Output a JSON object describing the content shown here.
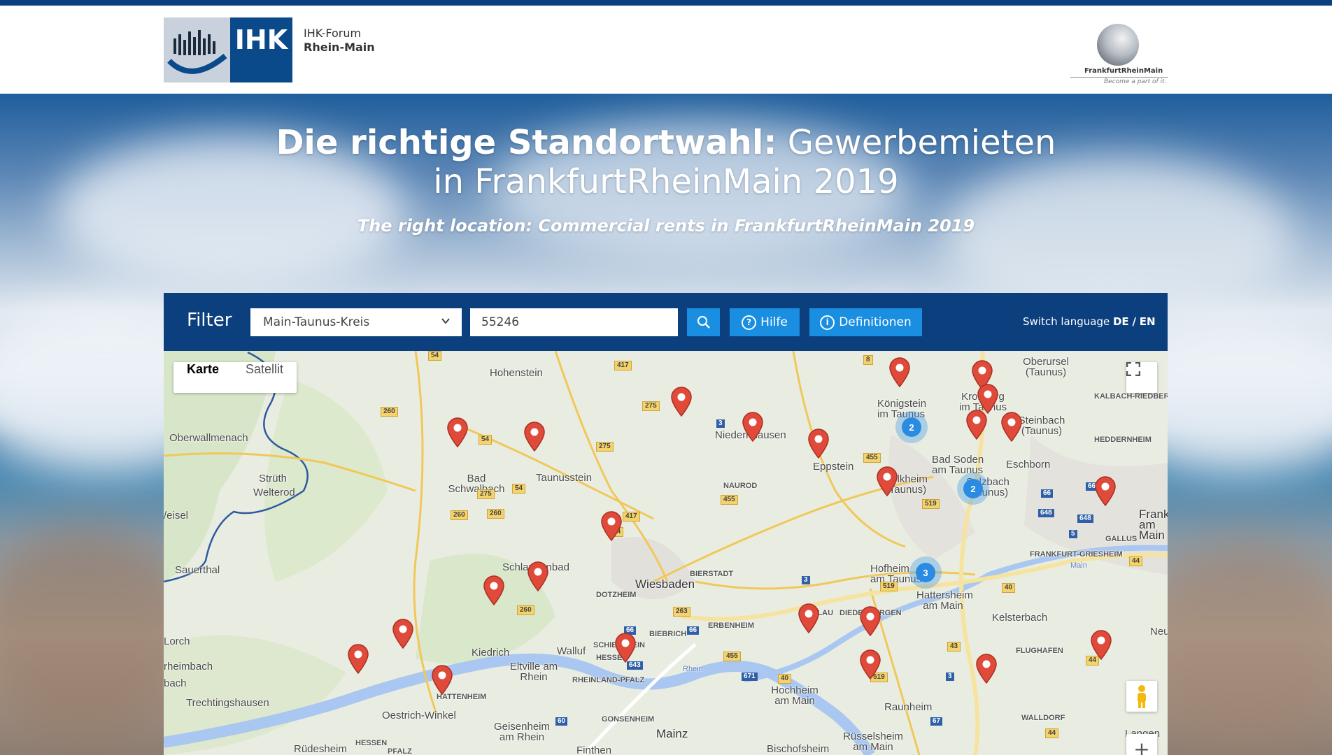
{
  "header": {
    "ihk_logo_text": "IHK",
    "forum_line1": "IHK-Forum",
    "forum_line2": "Rhein-Main",
    "frm_logo_name": "FrankfurtRheinMain",
    "frm_logo_tagline": "Become a part of it."
  },
  "hero": {
    "title_bold": "Die richtige Standortwahl:",
    "title_regular": "Gewerbemieten in FrankfurtRheinMain 2019",
    "subtitle": "The right location: Commercial rents in FrankfurtRheinMain 2019"
  },
  "filter": {
    "label": "Filter",
    "region_selected": "Main-Taunus-Kreis",
    "postal_code": "55246",
    "hilfe_label": "Hilfe",
    "definitionen_label": "Definitionen",
    "switch_language_label": "Switch language",
    "lang_de": "DE",
    "lang_sep": "/",
    "lang_en": "EN"
  },
  "map": {
    "type_map": "Karte",
    "type_satellite": "Satellit",
    "clusters": [
      "2",
      "2",
      "3"
    ],
    "places": {
      "hohenstein": "Hohenstein",
      "oberwallmenach": "Oberwallmenach",
      "strueth": "Strüth",
      "welterod": "Welterod",
      "eisel": "/eisel",
      "sauerthal": "Sauerthal",
      "orch": "Lorch",
      "rheimbach": "rheimbach",
      "bach": "bach",
      "trechtingshausen": "Trechtingshausen",
      "ruedesheim": "Rüdesheim",
      "bad_schwalbach": "Bad Schwalbach",
      "taunusstein": "Taunusstein",
      "niedernhausen": "Niedernhausen",
      "eppstein": "Eppstein",
      "koenigstein": "Königstein im Taunus",
      "kronberg": "Kronberg im Taunus",
      "oberursel": "Oberursel (Taunus)",
      "steinbach": "Steinbach (Taunus)",
      "eschborn": "Eschborn",
      "bad_soden": "Bad Soden am Taunus",
      "kelkheim": "Kelkheim (Taunus)",
      "sulzbach": "Sulzbach (Taunus)",
      "frankfurt": "Frankfurt am Main",
      "schlangenbad": "Schlangenbad",
      "wiesbaden": "Wiesbaden",
      "hofheim": "Hofheim am Taunus",
      "hattersheim": "Hattersheim am Main",
      "kelsterbach": "Kelsterbach",
      "kiedrich": "Kiedrich",
      "eltville": "Eltville am Rhein",
      "walluf": "Walluf",
      "oestrich": "Oestrich-Winkel",
      "geisenheim": "Geisenheim am Rhein",
      "mainz": "Mainz",
      "hochheim": "Hochheim am Main",
      "raunheim": "Raunheim",
      "ruesselsheim": "Rüsselsheim am Main",
      "bischofsheim": "Bischofsheim",
      "langen": "Langen",
      "flughafen": "FLUGHAFEN",
      "hessen1": "HESSEN",
      "rlp": "RHEINLAND-PFALZ",
      "hessen2": "HESSEN",
      "pfalz": "PFALZ",
      "schierstein": "SCHIERSTEIN",
      "biebrich": "BIEBRICH",
      "dotzheim": "DOTZHEIM",
      "bierstadt": "BIERSTADT",
      "erbenheim": "ERBENHEIM",
      "naurod": "NAUROD",
      "wallau": "WALLAU",
      "diedenbergen": "DIEDENBERGEN",
      "hattenheim": "HATTENHEIM",
      "gonsenheim": "GONSENHEIM",
      "heddernheim": "HEDDERNHEIM",
      "kalbach": "KALBACH-RIEDBERG",
      "gallus": "GALLUS",
      "griesheim": "FRANKFURT-GRIESHEIM",
      "walldorf": "WALLDORF",
      "finthen": "Finthen",
      "neu": "Neu",
      "main_river": "Main",
      "rhein_river": "Rhein"
    }
  },
  "colors": {
    "brand_navy": "#0b3f7e",
    "button_blue": "#1a8ee0",
    "pin_red": "#e04a3a",
    "cluster_blue": "#2a8be2"
  },
  "icons": [
    "search-icon",
    "help-circle-icon",
    "info-circle-icon",
    "chevron-down-icon",
    "fullscreen-icon",
    "pegman-icon",
    "map-pin-icon"
  ]
}
